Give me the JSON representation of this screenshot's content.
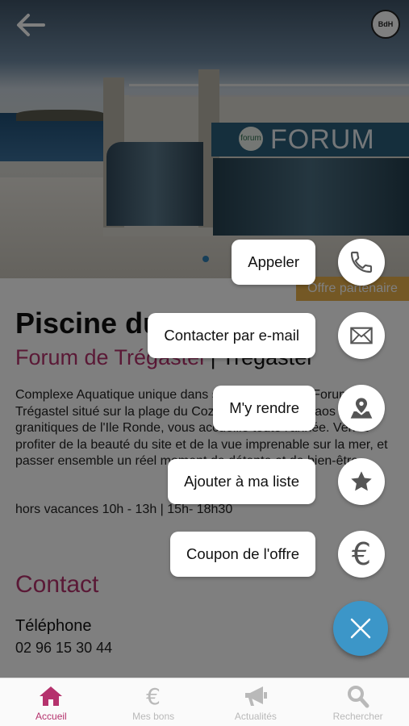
{
  "hero": {
    "sign_text": "FORUM",
    "sign_logo_text": "forum",
    "brand_logo_text": "BdH",
    "partner_tag": "Offre partenaire"
  },
  "place": {
    "title": "Piscine du Forum",
    "venue": "Forum de Trégastel",
    "separator": "|",
    "town": "Trégastel",
    "description": "Complexe Aquatique unique dans sa conception, le Forum de Trégastel situé sur la plage du Coz-Pors face aux chaos granitiques de l'Ile Ronde, vous accueille toute l'année. Venez profiter de la beauté du site et de la vue imprenable sur la mer, et passer ensemble un réel moment de détente et de bien-être.",
    "hours": "hors vacances 10h - 13h | 15h- 18h30"
  },
  "contact": {
    "heading": "Contact",
    "phone_label": "Téléphone",
    "phone_value": "02 96 15 30 44"
  },
  "actions": [
    {
      "label": "Appeler",
      "icon": "phone-icon"
    },
    {
      "label": "Contacter par e-mail",
      "icon": "envelope-icon"
    },
    {
      "label": "M'y rendre",
      "icon": "map-pin-icon"
    },
    {
      "label": "Ajouter à ma liste",
      "icon": "star-icon"
    },
    {
      "label": "Coupon de l'offre",
      "icon": "euro-icon",
      "glyph": "€"
    }
  ],
  "bottom_nav": [
    {
      "label": "Accueil",
      "icon": "home-icon",
      "active": true
    },
    {
      "label": "Mes bons",
      "icon": "euro-icon",
      "active": false
    },
    {
      "label": "Actualités",
      "icon": "megaphone-icon",
      "active": false
    },
    {
      "label": "Rechercher",
      "icon": "search-icon",
      "active": false
    }
  ],
  "colors": {
    "accent": "#b5326d",
    "fab": "#3c96c8",
    "partner_tag": "#e8b04a",
    "inactive_nav": "#b9b9b9"
  }
}
